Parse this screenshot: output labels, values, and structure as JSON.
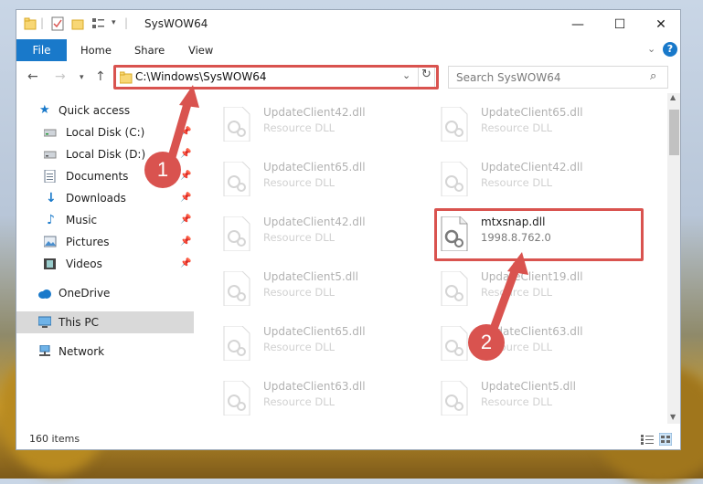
{
  "window": {
    "title": "SysWOW64",
    "controls": {
      "minimize": "—",
      "maximize": "☐",
      "close": "✕"
    }
  },
  "ribbon": {
    "tabs": [
      "File",
      "Home",
      "Share",
      "View"
    ],
    "help": "?"
  },
  "address": {
    "path": "C:\\Windows\\SysWOW64",
    "search_placeholder": "Search SysWOW64"
  },
  "sidebar": {
    "items": [
      {
        "label": "Quick access",
        "icon": "star-icon"
      },
      {
        "label": "Local Disk (C:)",
        "icon": "drive-icon",
        "pinned": true
      },
      {
        "label": "Local Disk (D:)",
        "icon": "drive-icon",
        "pinned": true
      },
      {
        "label": "Documents",
        "icon": "documents-icon",
        "pinned": true
      },
      {
        "label": "Downloads",
        "icon": "download-icon",
        "pinned": true
      },
      {
        "label": "Music",
        "icon": "music-icon",
        "pinned": true
      },
      {
        "label": "Pictures",
        "icon": "pictures-icon",
        "pinned": true
      },
      {
        "label": "Videos",
        "icon": "videos-icon",
        "pinned": true
      },
      {
        "label": "OneDrive",
        "icon": "cloud-icon"
      },
      {
        "label": "This PC",
        "icon": "computer-icon",
        "selected": true
      },
      {
        "label": "Network",
        "icon": "network-icon"
      }
    ]
  },
  "files": [
    {
      "name": "UpdateClient42.dll",
      "sub": "Resource DLL"
    },
    {
      "name": "UpdateClient65.dll",
      "sub": "Resource DLL"
    },
    {
      "name": "UpdateClient65.dll",
      "sub": "Resource DLL"
    },
    {
      "name": "UpdateClient42.dll",
      "sub": "Resource DLL"
    },
    {
      "name": "UpdateClient42.dll",
      "sub": "Resource DLL"
    },
    {
      "name": "mtxsnap.dll",
      "sub": "1998.8.762.0",
      "highlighted": true
    },
    {
      "name": "UpdateClient5.dll",
      "sub": "Resource DLL"
    },
    {
      "name": "UpdateClient19.dll",
      "sub": "Resource DLL"
    },
    {
      "name": "UpdateClient65.dll",
      "sub": "Resource DLL"
    },
    {
      "name": "UpdateClient63.dll",
      "sub": "Resource DLL"
    },
    {
      "name": "UpdateClient63.dll",
      "sub": "Resource DLL"
    },
    {
      "name": "UpdateClient5.dll",
      "sub": "Resource DLL"
    }
  ],
  "status": {
    "count": "160 items"
  },
  "annotations": {
    "step1": "1",
    "step2": "2",
    "color": "#d9534f"
  }
}
